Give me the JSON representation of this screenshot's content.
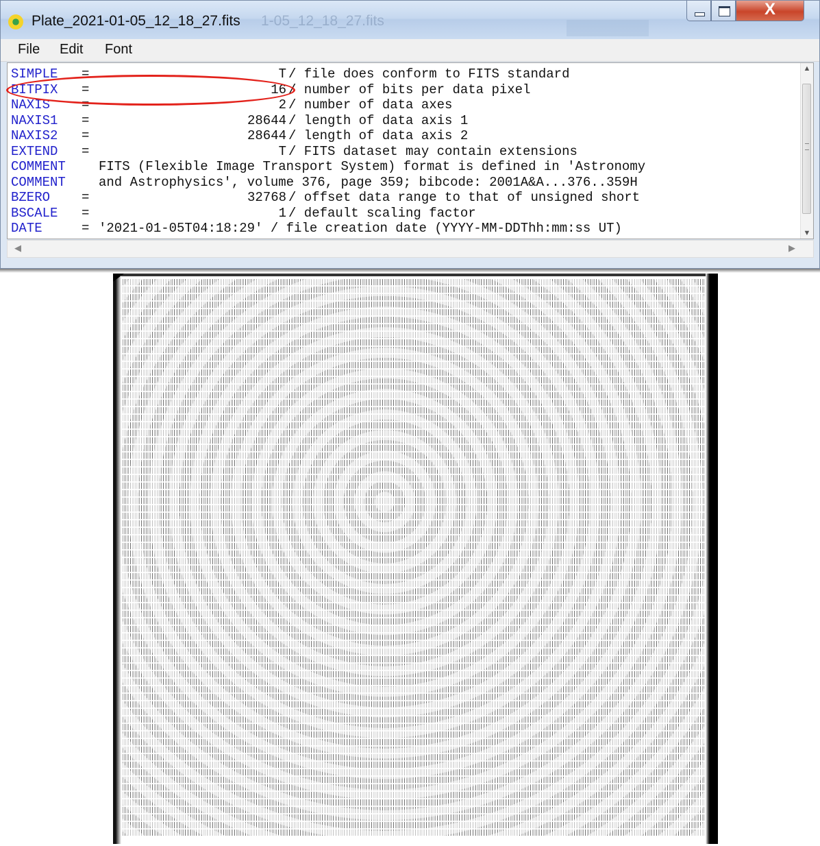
{
  "window": {
    "title": "Plate_2021-01-05_12_18_27.fits",
    "ghost_title": "1-05_12_18_27.fits",
    "close_glyph": "X"
  },
  "menu": [
    "File",
    "Edit",
    "Font"
  ],
  "header_lines": [
    {
      "key": "SIMPLE",
      "eq": "=",
      "value": "T",
      "comment": "/ file does conform to FITS standard"
    },
    {
      "key": "BITPIX",
      "eq": "=",
      "value": "16",
      "comment": "/ number of bits per data pixel"
    },
    {
      "key": "NAXIS",
      "eq": "=",
      "value": "2",
      "comment": "/ number of data axes"
    },
    {
      "key": "NAXIS1",
      "eq": "=",
      "value": "28644",
      "comment": "/ length of data axis 1"
    },
    {
      "key": "NAXIS2",
      "eq": "=",
      "value": "28644",
      "comment": "/ length of data axis 2"
    },
    {
      "key": "EXTEND",
      "eq": "=",
      "value": "T",
      "comment": "/ FITS dataset may contain extensions"
    },
    {
      "key": "COMMENT",
      "eq": "",
      "text": "FITS (Flexible Image Transport System) format is defined in 'Astronomy"
    },
    {
      "key": "COMMENT",
      "eq": "",
      "text": "and Astrophysics', volume 376, page 359; bibcode: 2001A&A...376..359H"
    },
    {
      "key": "BZERO",
      "eq": "=",
      "value": "32768",
      "comment": "/ offset data range to that of unsigned short"
    },
    {
      "key": "BSCALE",
      "eq": "=",
      "value": "1",
      "comment": "/ default scaling factor"
    },
    {
      "key": "DATE",
      "eq": "=",
      "text": "'2021-01-05T04:18:29' / file creation date (YYYY-MM-DDThh:mm:ss UT)"
    }
  ],
  "icons": {
    "app": "fits-viewer-icon",
    "minimize": "minimize-icon",
    "maximize": "maximize-icon",
    "close": "close-icon"
  },
  "colors": {
    "keyword": "#2222cc",
    "highlight": "#e3221b"
  }
}
